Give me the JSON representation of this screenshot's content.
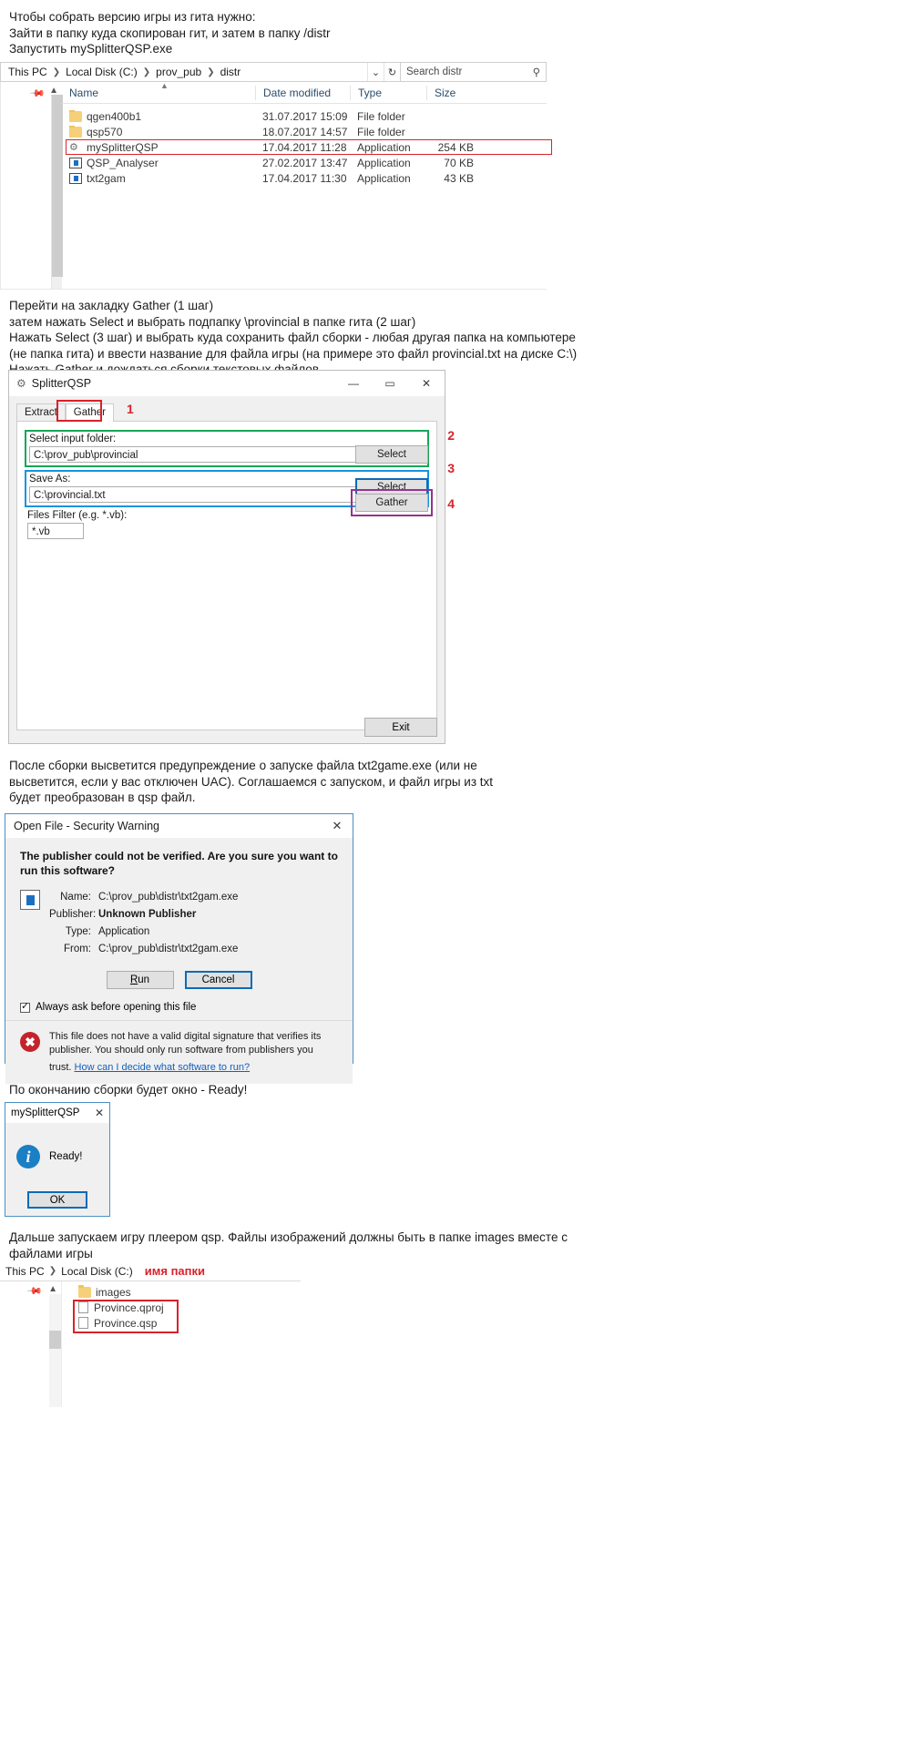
{
  "intro_text": "Чтобы собрать версию игры из гита нужно:\nЗайти в папку куда скопирован гит, и затем в папку /distr\nЗапустить mySplitterQSP.exe",
  "explorer1": {
    "breadcrumbs": [
      "This PC",
      "Local Disk (C:)",
      "prov_pub",
      "distr"
    ],
    "chevron_icon": "chevron-down-icon",
    "refresh_icon": "refresh-icon",
    "search_placeholder": "Search distr",
    "search_icon": "search-icon",
    "columns": [
      "Name",
      "Date modified",
      "Type",
      "Size"
    ],
    "rows": [
      {
        "name": "qgen400b1",
        "date": "31.07.2017 15:09",
        "type": "File folder",
        "size": "",
        "icon": "folder-icon"
      },
      {
        "name": "qsp570",
        "date": "18.07.2017 14:57",
        "type": "File folder",
        "size": "",
        "icon": "folder-icon"
      },
      {
        "name": "mySplitterQSP",
        "date": "17.04.2017 11:28",
        "type": "Application",
        "size": "254 KB",
        "icon": "gear-application-icon"
      },
      {
        "name": "QSP_Analyser",
        "date": "27.02.2017 13:47",
        "type": "Application",
        "size": "70 KB",
        "icon": "application-icon"
      },
      {
        "name": "txt2gam",
        "date": "17.04.2017 11:30",
        "type": "Application",
        "size": "43 KB",
        "icon": "application-icon"
      }
    ],
    "highlight_row_index": 2,
    "highlight_color": "#d9212a"
  },
  "instructions_2": "Перейти на закладку Gather (1 шаг)\nзатем нажать Select и выбрать подпапку \\provincial в папке гита (2 шаг)\nНажать Select (3 шаг) и выбрать куда сохранить файл сборки - любая другая папка на компьютере\n(не папка гита) и ввести название для файла игры (на примере это файл provincial.txt на диске C:\\)\nНажать Gather и дождаться сборки текстовых файлов.",
  "splitter": {
    "title": "SplitterQSP",
    "title_icon": "gear-icon",
    "minimize_label": "—",
    "maximize_label": "▭",
    "close_label": "✕",
    "tabs": [
      {
        "label": "Extract",
        "active": false
      },
      {
        "label": "Gather",
        "active": true
      }
    ],
    "steps": {
      "one": "1",
      "two": "2",
      "three": "3",
      "four": "4"
    },
    "input_folder_label": "Select input folder:",
    "input_folder_value": "C:\\prov_pub\\provincial",
    "input_select_label": "Select",
    "save_as_label": "Save As:",
    "save_as_value": "C:\\provincial.txt",
    "save_select_label": "Select",
    "filter_label": "Files Filter (e.g. *.vb):",
    "filter_value": "*.vb",
    "gather_label": "Gather",
    "exit_label": "Exit",
    "accent_green": "#18a558",
    "accent_blue": "#1494dd",
    "accent_purple": "#93338f",
    "accent_red": "#d9212a"
  },
  "instructions_3": "После сборки высветится предупреждение о запуске файла txt2game.exe (или не\nвысветится, если у вас отключен UAC). Соглашаемся с запуском, и файл игры из txt\nбудет преобразован в qsp файл.",
  "security_warning": {
    "title": "Open File - Security Warning",
    "close_label": "✕",
    "question": "The publisher could not be verified.  Are you sure you want to run this software?",
    "file_icon": "application-icon",
    "fields": [
      {
        "key": "Name:",
        "value": "C:\\prov_pub\\distr\\txt2gam.exe",
        "bold": false
      },
      {
        "key": "Publisher:",
        "value": "Unknown Publisher",
        "bold": true
      },
      {
        "key": "Type:",
        "value": "Application",
        "bold": false
      },
      {
        "key": "From:",
        "value": "C:\\prov_pub\\distr\\txt2gam.exe",
        "bold": false
      }
    ],
    "run_label": "Run",
    "cancel_label": "Cancel",
    "checkbox_label": "Always ask before opening this file",
    "checkbox_checked": true,
    "warning_icon": "red-shield-x-icon",
    "warning_text": "This file does not have a valid digital signature that verifies its publisher.  You should only run software from publishers you trust.",
    "warning_link": "How can I decide what software to run?",
    "link_color": "#1560bd"
  },
  "instructions_4": "По окончанию сборки будет окно - Ready!",
  "ready_dialog": {
    "title": "mySplitterQSP",
    "close_label": "✕",
    "info_icon": "info-icon",
    "message": "Ready!",
    "ok_label": "OK"
  },
  "instructions_5": "Дальше запускаем игру плеером qsp. Файлы изображений должны быть в папке images вместе с\nфайлами игры",
  "explorer2": {
    "breadcrumbs": [
      "This PC",
      "Local Disk (C:)"
    ],
    "annotation": "имя папки",
    "annotation_color": "#d9212a",
    "rows": [
      {
        "name": "images",
        "icon": "folder-icon"
      },
      {
        "name": "Province.qproj",
        "icon": "document-icon"
      },
      {
        "name": "Province.qsp",
        "icon": "document-icon"
      }
    ],
    "highlight_color": "#d9212a"
  }
}
